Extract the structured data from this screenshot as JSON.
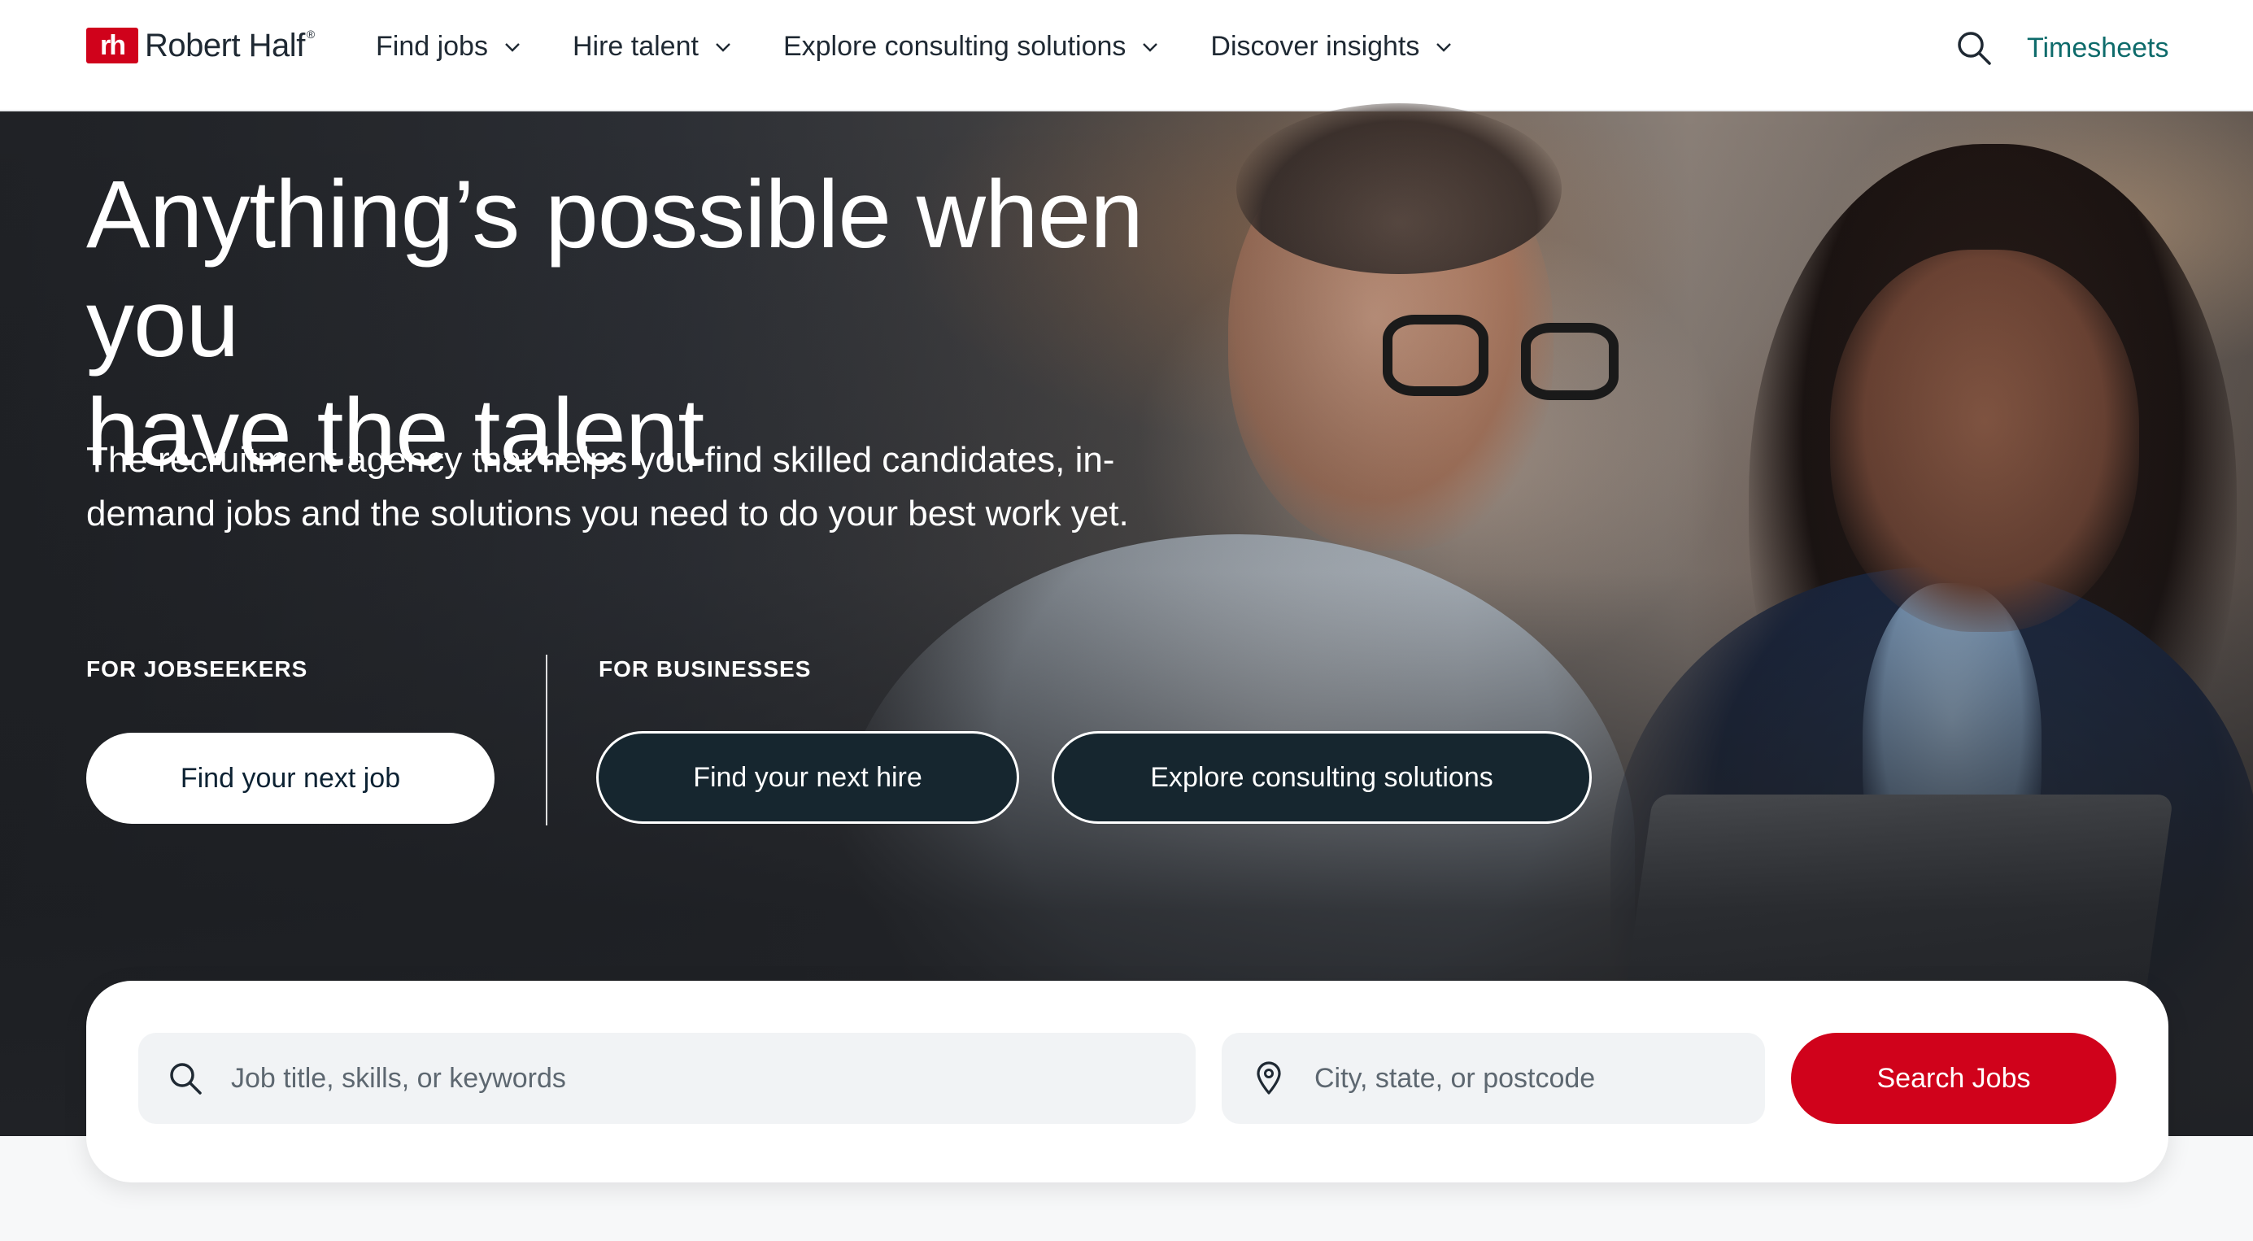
{
  "brand": {
    "name": "Robert Half",
    "mark": "rh",
    "registered": "®",
    "accent": "#d0021b"
  },
  "nav": {
    "items": [
      {
        "label": "Find jobs"
      },
      {
        "label": "Hire talent"
      },
      {
        "label": "Explore consulting solutions"
      },
      {
        "label": "Discover insights"
      }
    ],
    "timesheets": "Timesheets",
    "search_icon": "search-icon"
  },
  "hero": {
    "headline_line1": "Anything’s possible when you",
    "headline_line2": "have the talent",
    "subhead_line1": "The recruitment agency that helps you find skilled candidates, in-",
    "subhead_line2": "demand jobs and the solutions you need to do your best work yet.",
    "jobseekers": {
      "label": "FOR JOBSEEKERS",
      "button": "Find your next job"
    },
    "businesses": {
      "label": "FOR BUSINESSES",
      "button_hire": "Find your next hire",
      "button_consulting": "Explore consulting solutions"
    }
  },
  "search": {
    "keywords_placeholder": "Job title, skills, or keywords",
    "location_placeholder": "City, state, or postcode",
    "button": "Search Jobs"
  },
  "colors": {
    "accent_red": "#d0021b",
    "teal_link": "#0e6b6b",
    "dark_button": "#16262f"
  }
}
